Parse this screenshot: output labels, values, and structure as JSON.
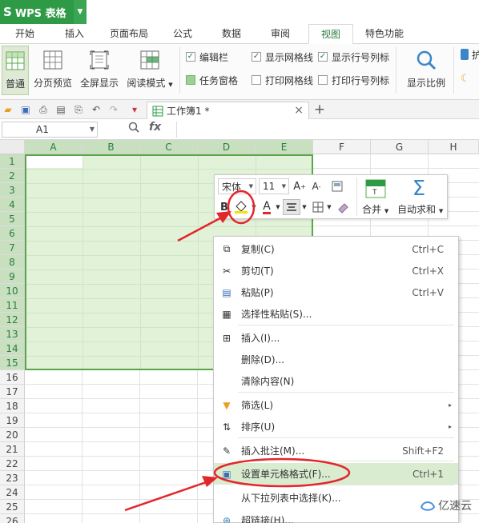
{
  "app": {
    "title": "WPS 表格"
  },
  "menu": {
    "tabs": [
      "开始",
      "插入",
      "页面布局",
      "公式",
      "数据",
      "审阅",
      "视图",
      "特色功能"
    ],
    "active": "视图"
  },
  "ribbon": {
    "normal": "普通",
    "page_preview": "分页预览",
    "fullscreen": "全屏显示",
    "reading_mode": "阅读模式",
    "edit_bar": "编辑栏",
    "task_pane": "任务窗格",
    "show_gridlines": "显示网格线",
    "print_gridlines": "打印网格线",
    "show_rowcol": "显示行号列标",
    "print_rowcol": "打印行号列标",
    "zoom": "显示比例",
    "truncated": "护"
  },
  "doc": {
    "tab_label": "工作簿1 *"
  },
  "formula": {
    "cell_ref": "A1",
    "fx": "fx"
  },
  "grid": {
    "columns": [
      "A",
      "B",
      "C",
      "D",
      "E",
      "F",
      "G",
      "H"
    ],
    "rows": [
      "1",
      "2",
      "3",
      "4",
      "5",
      "6",
      "7",
      "8",
      "9",
      "10",
      "11",
      "12",
      "13",
      "14",
      "15",
      "16",
      "17",
      "18",
      "19",
      "20",
      "21",
      "22",
      "23",
      "24",
      "25",
      "26"
    ]
  },
  "mini_toolbar": {
    "font": "宋体",
    "size": "11",
    "bold": "B",
    "font_color": "A",
    "merge": "合并",
    "autosum": "自动求和"
  },
  "context_menu": {
    "items": [
      {
        "label": "复制(C)",
        "shortcut": "Ctrl+C",
        "icon": "copy-icon"
      },
      {
        "label": "剪切(T)",
        "shortcut": "Ctrl+X",
        "icon": "scissors-icon"
      },
      {
        "label": "粘贴(P)",
        "shortcut": "Ctrl+V",
        "icon": "paste-icon"
      },
      {
        "label": "选择性粘贴(S)...",
        "shortcut": "",
        "icon": "paste-special-icon"
      },
      {
        "label": "插入(I)...",
        "shortcut": "",
        "icon": "insert-cells-icon"
      },
      {
        "label": "删除(D)...",
        "shortcut": "",
        "icon": ""
      },
      {
        "label": "清除内容(N)",
        "shortcut": "",
        "icon": ""
      },
      {
        "label": "筛选(L)",
        "shortcut": "",
        "icon": "filter-icon"
      },
      {
        "label": "排序(U)",
        "shortcut": "",
        "icon": "sort-icon"
      },
      {
        "label": "插入批注(M)...",
        "shortcut": "Shift+F2",
        "icon": "comment-icon"
      },
      {
        "label": "设置单元格格式(F)...",
        "shortcut": "Ctrl+1",
        "icon": "format-cells-icon"
      },
      {
        "label": "从下拉列表中选择(K)...",
        "shortcut": "",
        "icon": ""
      },
      {
        "label": "超链接(H)...",
        "shortcut": "",
        "icon": "hyperlink-icon"
      }
    ]
  },
  "watermark": {
    "text": "亿速云"
  },
  "colors": {
    "brand": "#2f9a46",
    "selection_fill": "#e1f2d8",
    "selection_border": "#5aa74a",
    "annotation_red": "#e3262b"
  }
}
